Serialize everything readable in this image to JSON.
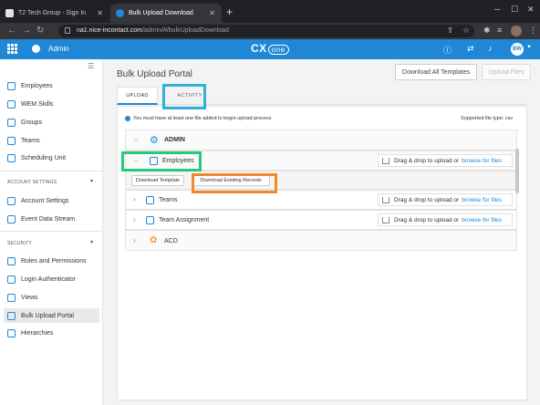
{
  "browser": {
    "tabs": [
      {
        "title": "T2 Tech Group - Sign In"
      },
      {
        "title": "Bulk Upload Download"
      }
    ],
    "url_host": "na1.nice-incontact.com",
    "url_path": "/admin/#/bulkUploadDownload"
  },
  "header": {
    "app_name": "Admin",
    "logo_text": "CX",
    "logo_suffix": "one",
    "user_initials": "BW"
  },
  "sidebar": {
    "items_top": [
      {
        "label": "Employees",
        "icon": "user-icon"
      },
      {
        "label": "WEM Skills",
        "icon": "skills-icon"
      },
      {
        "label": "Groups",
        "icon": "groups-icon"
      },
      {
        "label": "Teams",
        "icon": "teams-icon"
      },
      {
        "label": "Scheduling Unit",
        "icon": "calendar-icon"
      }
    ],
    "section_account": "ACCOUNT SETTINGS",
    "items_account": [
      {
        "label": "Account Settings",
        "icon": "settings-icon"
      },
      {
        "label": "Event Data Stream",
        "icon": "stream-icon"
      }
    ],
    "section_security": "SECURITY",
    "items_security": [
      {
        "label": "Roles and Permissions",
        "icon": "roles-icon"
      },
      {
        "label": "Login Authenticator",
        "icon": "key-icon"
      },
      {
        "label": "Views",
        "icon": "views-icon"
      },
      {
        "label": "Bulk Upload Portal",
        "icon": "upload-icon",
        "active": true
      },
      {
        "label": "Hierarchies",
        "icon": "hierarchy-icon"
      }
    ]
  },
  "main": {
    "title": "Bulk Upload Portal",
    "download_all_label": "Download All Templates",
    "upload_files_label": "Upload Files",
    "tabs": [
      {
        "label": "UPLOAD",
        "active": true
      },
      {
        "label": "ACTIVITY",
        "active": false
      }
    ],
    "notice": "You must have at least one file added to begin upload process",
    "supported": "Supported file type: csv",
    "tree": {
      "admin_label": "ADMIN",
      "employees_label": "Employees",
      "download_template_label": "Download Template",
      "download_existing_label": "Download Existing Records",
      "teams_label": "Teams",
      "team_assignment_label": "Team Assignment",
      "acd_label": "ACD",
      "drop_text": "Drag & drop to upload or",
      "browse_text": "browse for files"
    }
  },
  "colors": {
    "accent": "#1f87d6",
    "highlight_activity": "#30b0dc",
    "highlight_employees": "#27c77d",
    "highlight_existing": "#ef8a2b"
  }
}
